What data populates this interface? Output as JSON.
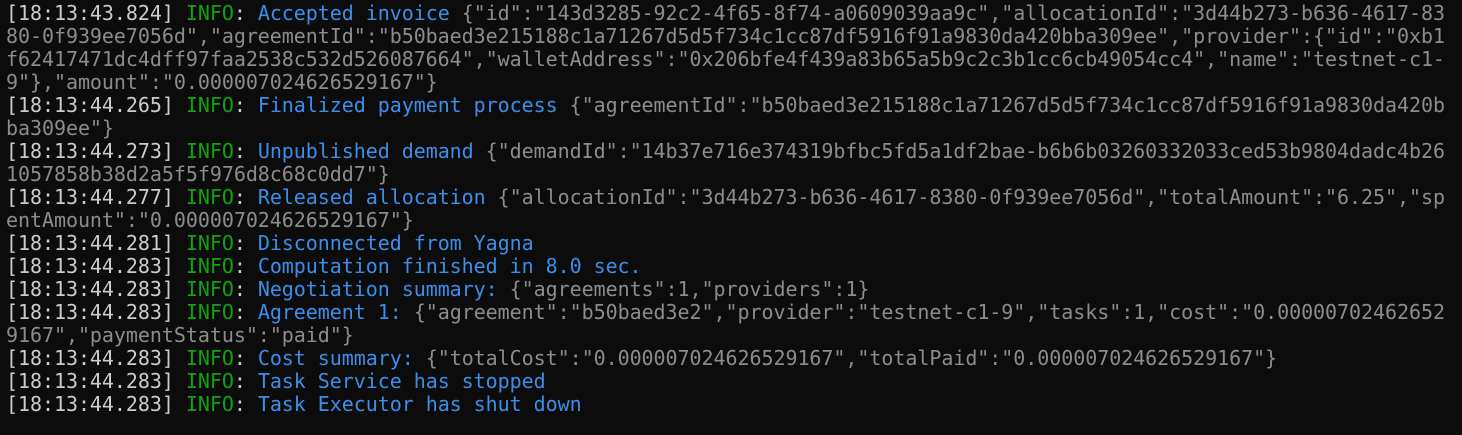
{
  "terminal": {
    "colors": {
      "background": "#0c0c0c",
      "timestamp": "#cccccc",
      "level": "#13a10e",
      "message": "#3b8eea",
      "json": "#8c8c8c"
    },
    "lines": [
      {
        "ts": "[18:13:43.824]",
        "level": "INFO",
        "msg": "Accepted invoice",
        "json": "{\"id\":\"143d3285-92c2-4f65-8f74-a0609039aa9c\",\"allocationId\":\"3d44b273-b636-4617-8380-0f939ee7056d\",\"agreementId\":\"b50baed3e215188c1a71267d5d5f734c1cc87df5916f91a9830da420bba309ee\",\"provider\":{\"id\":\"0xb1f62417471dc4dff97faa2538c532d526087664\",\"walletAddress\":\"0x206bfe4f439a83b65a5b9c2c3b1cc6cb49054cc4\",\"name\":\"testnet-c1-9\"},\"amount\":\"0.000007024626529167\"}"
      },
      {
        "ts": "[18:13:44.265]",
        "level": "INFO",
        "msg": "Finalized payment process",
        "json": "{\"agreementId\":\"b50baed3e215188c1a71267d5d5f734c1cc87df5916f91a9830da420bba309ee\"}"
      },
      {
        "ts": "[18:13:44.273]",
        "level": "INFO",
        "msg": "Unpublished demand",
        "json": "{\"demandId\":\"14b37e716e374319bfbc5fd5a1df2bae-b6b6b03260332033ced53b9804dadc4b261057858b38d2a5f5f976d8c68c0dd7\"}"
      },
      {
        "ts": "[18:13:44.277]",
        "level": "INFO",
        "msg": "Released allocation",
        "json": "{\"allocationId\":\"3d44b273-b636-4617-8380-0f939ee7056d\",\"totalAmount\":\"6.25\",\"spentAmount\":\"0.000007024626529167\"}"
      },
      {
        "ts": "[18:13:44.281]",
        "level": "INFO",
        "msg": "Disconnected from Yagna",
        "json": ""
      },
      {
        "ts": "[18:13:44.283]",
        "level": "INFO",
        "msg": "Computation finished in 8.0 sec.",
        "json": ""
      },
      {
        "ts": "[18:13:44.283]",
        "level": "INFO",
        "msg": "Negotiation summary:",
        "json": "{\"agreements\":1,\"providers\":1}"
      },
      {
        "ts": "[18:13:44.283]",
        "level": "INFO",
        "msg": "Agreement 1:",
        "json": "{\"agreement\":\"b50baed3e2\",\"provider\":\"testnet-c1-9\",\"tasks\":1,\"cost\":\"0.000007024626529167\",\"paymentStatus\":\"paid\"}"
      },
      {
        "ts": "[18:13:44.283]",
        "level": "INFO",
        "msg": "Cost summary:",
        "json": "{\"totalCost\":\"0.000007024626529167\",\"totalPaid\":\"0.000007024626529167\"}"
      },
      {
        "ts": "[18:13:44.283]",
        "level": "INFO",
        "msg": "Task Service has stopped",
        "json": ""
      },
      {
        "ts": "[18:13:44.283]",
        "level": "INFO",
        "msg": "Task Executor has shut down",
        "json": ""
      }
    ]
  }
}
